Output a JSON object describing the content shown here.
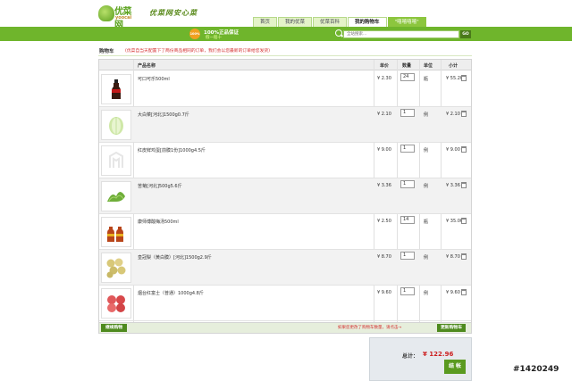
{
  "header": {
    "logo_text": "优菜网",
    "logo_sub": "yoocai",
    "slogan": "优菜网安心菜",
    "nav": [
      "首页",
      "我的优菜",
      "优菜百科",
      "我的购物车",
      "\"嘻嘻嘻嘻\""
    ],
    "active_nav": 3
  },
  "bar": {
    "badge": "100%",
    "guarantee": "100%正品保证",
    "guarantee_sub": "假一赔十",
    "search_placeholder": "全站搜索...",
    "search_button": "GO"
  },
  "cart": {
    "title": "购物车",
    "note": "(优菜自当天配置下了两份商品相同的订单，我们会以您最新的订单给您发货)",
    "columns": [
      "产品名称",
      "单价",
      "数量",
      "单位",
      "小计"
    ],
    "items": [
      {
        "name": "可口可乐500ml",
        "price": "¥ 2.30",
        "qty": "24",
        "unit": "瓶",
        "subtotal": "¥ 55.20",
        "img": "cola"
      },
      {
        "name": "大白菜[河北]1500g0.7斤",
        "price": "¥ 2.10",
        "qty": "1",
        "unit": "例",
        "subtotal": "¥ 2.10",
        "img": "cabbage"
      },
      {
        "name": "红皮鲜鸡蛋[前膜1份]1000g4.5斤",
        "price": "¥ 9.00",
        "qty": "1",
        "unit": "例",
        "subtotal": "¥ 9.00",
        "img": "placeholder"
      },
      {
        "name": "苦菊[河北]500g5.6斤",
        "price": "¥ 3.36",
        "qty": "1",
        "unit": "例",
        "subtotal": "¥ 3.36",
        "img": "endive"
      },
      {
        "name": "康师傅酸梅汤500ml",
        "price": "¥ 2.50",
        "qty": "14",
        "unit": "瓶",
        "subtotal": "¥ 35.00",
        "img": "bottles"
      },
      {
        "name": "皇冠梨（黄白膜）[河北]1500g2.9斤",
        "price": "¥ 8.70",
        "qty": "1",
        "unit": "例",
        "subtotal": "¥ 8.70",
        "img": "pears"
      },
      {
        "name": "烟台红富士（普通）1000g4.8斤",
        "price": "¥ 9.60",
        "qty": "1",
        "unit": "例",
        "subtotal": "¥ 9.60",
        "img": "apples"
      }
    ],
    "continue_button": "继续购物",
    "update_note": "如果您更改了购物车数量，请点击→",
    "update_button": "更新购物车"
  },
  "summary": {
    "total_label": "总计：",
    "total_value": "¥ 122.96",
    "checkout_button": "结 帐"
  },
  "watermark": "#1420249",
  "colors": {
    "brand_green": "#6fb52c",
    "dark_green": "#4e8a1e",
    "alert_red": "#d43030"
  }
}
